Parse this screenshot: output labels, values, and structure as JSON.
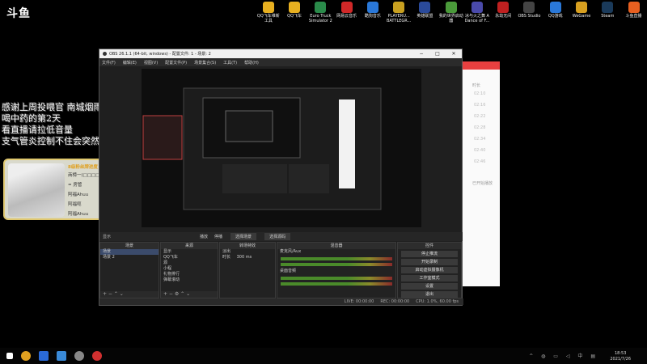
{
  "desktop": {
    "logo": "斗鱼",
    "icons": [
      {
        "label": "QQ飞车维新工具",
        "color": "#e8b020"
      },
      {
        "label": "QQ飞车",
        "color": "#e8b020"
      },
      {
        "label": "Euro Truck Simulator 2",
        "color": "#2a8a4a"
      },
      {
        "label": "网易云音乐",
        "color": "#d02828"
      },
      {
        "label": "酷狗音乐",
        "color": "#2a78d8"
      },
      {
        "label": "PLAYERU... BATTLEGR...",
        "color": "#c8a020"
      },
      {
        "label": "英雄联盟",
        "color": "#2a4a9a"
      },
      {
        "label": "我的世界启动器",
        "color": "#4a9a3a"
      },
      {
        "label": "冰与火之舞 A Dance of F...",
        "color": "#4a4aaa"
      },
      {
        "label": "永劫无间",
        "color": "#c02020"
      },
      {
        "label": "OBS Studio",
        "color": "#444444"
      },
      {
        "label": "QQ游戏",
        "color": "#2a78d8"
      },
      {
        "label": "WeGame",
        "color": "#d8a020"
      },
      {
        "label": "Steam",
        "color": "#1a3a5a"
      },
      {
        "label": "斗鱼直播",
        "color": "#e86020"
      }
    ]
  },
  "overlay": {
    "lines": [
      "感谢上周投喂官   南城烟雨s",
      "喝中药的第2天",
      "看直播请拉低音量",
      "支气管炎控制不住会突然咳嗽"
    ]
  },
  "panel": {
    "rank_title": "8级粉丝牌进度",
    "rows": [
      "商榜一(□□□□)",
      "= 房管",
      "阿福Ahuu",
      "阿福呃",
      "阿福Ahuu"
    ]
  },
  "obs": {
    "title": "OBS 26.1.1 (64-bit, windows) - 配置文件: 1 - 场景: 2",
    "menu": [
      "文件(F)",
      "编辑(E)",
      "视图(V)",
      "配置文件(P)",
      "场景集合(S)",
      "工具(T)",
      "帮助(H)"
    ],
    "scene_tag": "显示",
    "radio1": "播放",
    "radio2": "停播",
    "btn1": "选择场景",
    "btn2": "选择源码",
    "docks": {
      "scenes": {
        "title": "场景",
        "items": [
          "场景",
          "场景 2"
        ]
      },
      "sources": {
        "title": "来源",
        "items": [
          "显示",
          "QQ飞车",
          "源",
          "小程",
          "礼物排行",
          "弹幕滚动"
        ]
      },
      "transitions": {
        "title": "转场特效",
        "value": "淡出",
        "duration_label": "时长",
        "duration_value": "300 ms"
      },
      "mixer": {
        "title": "混音器",
        "channels": [
          "麦克风/Aux",
          "桌面音频"
        ]
      },
      "controls": {
        "title": "控件",
        "buttons": [
          "停止推流",
          "开始录制",
          "启动虚拟摄像机",
          "工作室模式",
          "设置",
          "退出"
        ]
      }
    },
    "status": [
      "LIVE: 00:00:00",
      "REC: 00:00:00",
      "CPU: 1.0%, 60.00 fps"
    ]
  },
  "sidewin": {
    "label": "时长",
    "hours": [
      "02:10",
      "02:16",
      "02:22",
      "02:28",
      "02:34",
      "02:40",
      "02:46"
    ],
    "footer": "已开始播放"
  },
  "taskbar": {
    "time": "18:53",
    "date": "2021/7/26"
  }
}
